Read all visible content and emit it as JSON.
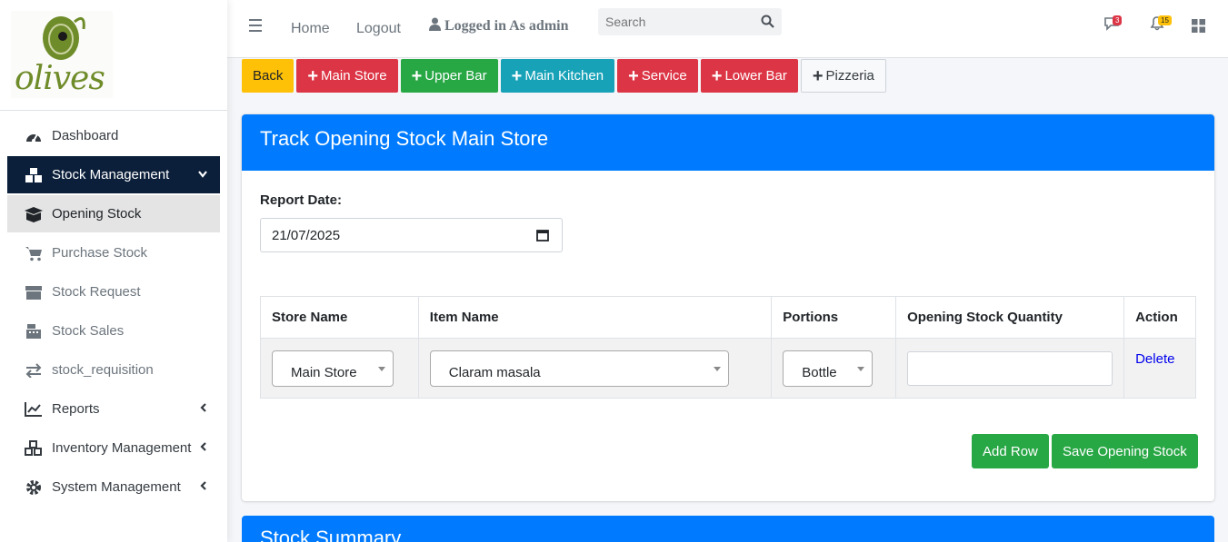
{
  "brand": {
    "logo_text": "olives"
  },
  "sidebar": {
    "items": [
      {
        "label": "Dashboard",
        "icon": "tachometer-icon"
      },
      {
        "label": "Stock Management",
        "icon": "boxes-icon"
      },
      {
        "label": "Opening Stock",
        "icon": "open-box-icon"
      },
      {
        "label": "Purchase Stock",
        "icon": "cart-icon"
      },
      {
        "label": "Stock Request",
        "icon": "box-icon"
      },
      {
        "label": "Stock Sales",
        "icon": "cash-register-icon"
      },
      {
        "label": "stock_requisition",
        "icon": "exchange-icon"
      },
      {
        "label": "Reports",
        "icon": "line-chart-icon"
      },
      {
        "label": "Inventory Management",
        "icon": "cubes-icon"
      },
      {
        "label": "System Management",
        "icon": "gear-icon"
      }
    ]
  },
  "topbar": {
    "home": "Home",
    "logout": "Logout",
    "logged_in": "Logged in As admin",
    "search_placeholder": "Search",
    "messages_count": "3",
    "notifications_count": "15"
  },
  "buttons": {
    "back": "Back",
    "main_store": "Main Store",
    "upper_bar": "Upper Bar",
    "main_kitchen": "Main Kitchen",
    "service": "Service",
    "lower_bar": "Lower Bar",
    "pizzeria": "Pizzeria"
  },
  "card": {
    "title": "Track Opening Stock Main Store",
    "report_date_label": "Report Date:",
    "report_date_value": "21/07/2025",
    "table": {
      "headers": [
        "Store Name",
        "Item Name",
        "Portions",
        "Opening Stock Quantity",
        "Action"
      ],
      "row": {
        "store": "Main Store",
        "item": "Claram masala",
        "portion": "Bottle",
        "quantity": "",
        "action": "Delete"
      }
    },
    "add_row": "Add Row",
    "save": "Save Opening Stock"
  },
  "summary": {
    "title": "Stock Summary"
  },
  "colors": {
    "primary": "#007bff",
    "danger": "#dc3545",
    "success": "#28a745",
    "info": "#17a2b8",
    "warning": "#ffc107",
    "sidebar_active": "#0b1f3a"
  }
}
